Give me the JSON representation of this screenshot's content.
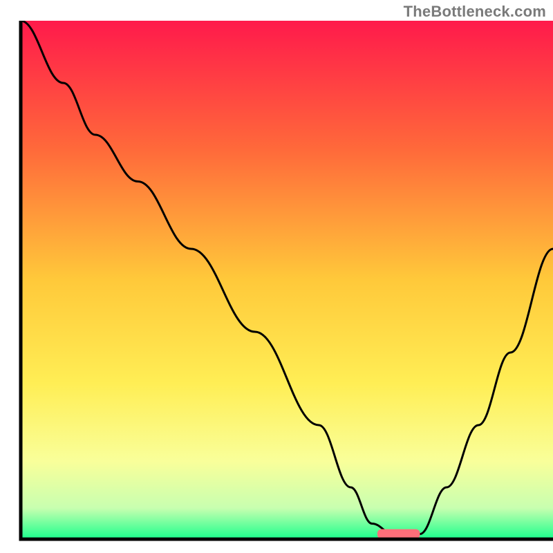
{
  "watermark": "TheBottleneck.com",
  "chart_data": {
    "type": "line",
    "title": "",
    "xlabel": "",
    "ylabel": "",
    "xlim": [
      0,
      100
    ],
    "ylim": [
      0,
      100
    ],
    "grid": false,
    "legend": false,
    "background_gradient": {
      "stops": [
        {
          "offset": 0.0,
          "color": "#ff1a4b"
        },
        {
          "offset": 0.25,
          "color": "#ff6a3a"
        },
        {
          "offset": 0.5,
          "color": "#ffc93a"
        },
        {
          "offset": 0.7,
          "color": "#ffee55"
        },
        {
          "offset": 0.85,
          "color": "#f9ff9a"
        },
        {
          "offset": 0.94,
          "color": "#c8ffb0"
        },
        {
          "offset": 1.0,
          "color": "#19ff8c"
        }
      ]
    },
    "series": [
      {
        "name": "bottleneck-curve",
        "x": [
          0,
          8,
          14,
          22,
          32,
          44,
          56,
          62,
          66,
          70,
          75,
          80,
          86,
          92,
          100
        ],
        "y": [
          100,
          88,
          78,
          69,
          56,
          40,
          22,
          10,
          3,
          1,
          1,
          10,
          22,
          36,
          56
        ]
      }
    ],
    "marker": {
      "name": "optimal-range",
      "x_range": [
        67,
        75
      ],
      "y": 1,
      "color": "#ff6f7a"
    },
    "axes_visible": true
  }
}
